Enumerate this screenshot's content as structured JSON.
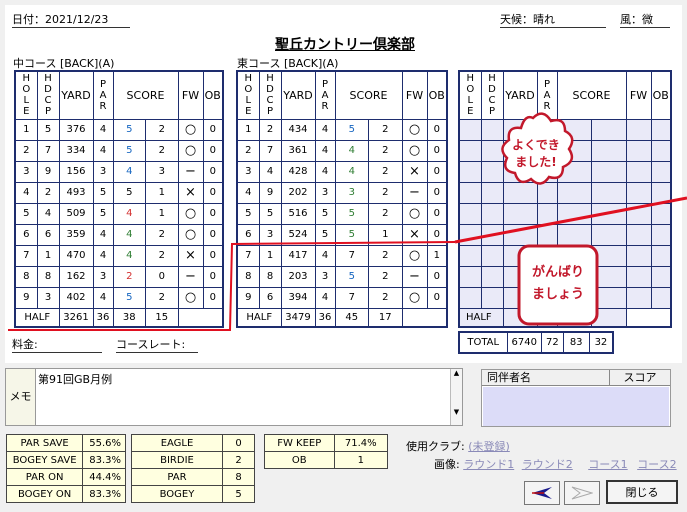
{
  "header": {
    "date_label": "日付：2021/12/23",
    "weather_label": "天候：晴れ",
    "wind_label": "風：微",
    "club_name": "聖丘カントリー倶楽部"
  },
  "course_in": {
    "label": "中コース [BACK](A)"
  },
  "course_out": {
    "label": "東コース [BACK](A)"
  },
  "columns": {
    "hole": "HOLE",
    "hdcp": "HDCP",
    "yard": "YARD",
    "par": "PAR",
    "score": "SCORE",
    "fw": "FW",
    "ob": "OB"
  },
  "rows_in": [
    {
      "hole": "1",
      "hdcp": "5",
      "yard": "376",
      "par": "4",
      "score": "5",
      "putt": "2",
      "fw": "○",
      "ob": "0",
      "color": "blue"
    },
    {
      "hole": "2",
      "hdcp": "7",
      "yard": "334",
      "par": "4",
      "score": "5",
      "putt": "2",
      "fw": "○",
      "ob": "0",
      "color": "blue"
    },
    {
      "hole": "3",
      "hdcp": "9",
      "yard": "156",
      "par": "3",
      "score": "4",
      "putt": "3",
      "fw": "−",
      "ob": "0",
      "color": "blue"
    },
    {
      "hole": "4",
      "hdcp": "2",
      "yard": "493",
      "par": "5",
      "score": "5",
      "putt": "1",
      "fw": "×",
      "ob": "0",
      "color": "black"
    },
    {
      "hole": "5",
      "hdcp": "4",
      "yard": "509",
      "par": "5",
      "score": "4",
      "putt": "1",
      "fw": "○",
      "ob": "0",
      "color": "red"
    },
    {
      "hole": "6",
      "hdcp": "6",
      "yard": "359",
      "par": "4",
      "score": "4",
      "putt": "2",
      "fw": "○",
      "ob": "0",
      "color": "green"
    },
    {
      "hole": "7",
      "hdcp": "1",
      "yard": "470",
      "par": "4",
      "score": "4",
      "putt": "2",
      "fw": "×",
      "ob": "0",
      "color": "green"
    },
    {
      "hole": "8",
      "hdcp": "8",
      "yard": "162",
      "par": "3",
      "score": "2",
      "putt": "0",
      "fw": "−",
      "ob": "0",
      "color": "red"
    },
    {
      "hole": "9",
      "hdcp": "3",
      "yard": "402",
      "par": "4",
      "score": "5",
      "putt": "2",
      "fw": "○",
      "ob": "0",
      "color": "blue"
    }
  ],
  "half_in": {
    "label": "HALF",
    "yard": "3261",
    "par": "36",
    "score": "38",
    "putt": "15"
  },
  "rows_out": [
    {
      "hole": "1",
      "hdcp": "2",
      "yard": "434",
      "par": "4",
      "score": "5",
      "putt": "2",
      "fw": "○",
      "ob": "0",
      "color": "blue"
    },
    {
      "hole": "2",
      "hdcp": "7",
      "yard": "361",
      "par": "4",
      "score": "4",
      "putt": "2",
      "fw": "○",
      "ob": "0",
      "color": "green"
    },
    {
      "hole": "3",
      "hdcp": "4",
      "yard": "428",
      "par": "4",
      "score": "4",
      "putt": "2",
      "fw": "×",
      "ob": "0",
      "color": "green"
    },
    {
      "hole": "4",
      "hdcp": "9",
      "yard": "202",
      "par": "3",
      "score": "3",
      "putt": "2",
      "fw": "−",
      "ob": "0",
      "color": "green"
    },
    {
      "hole": "5",
      "hdcp": "5",
      "yard": "516",
      "par": "5",
      "score": "5",
      "putt": "2",
      "fw": "○",
      "ob": "0",
      "color": "green"
    },
    {
      "hole": "6",
      "hdcp": "3",
      "yard": "524",
      "par": "5",
      "score": "5",
      "putt": "1",
      "fw": "×",
      "ob": "0",
      "color": "green"
    },
    {
      "hole": "7",
      "hdcp": "1",
      "yard": "417",
      "par": "4",
      "score": "7",
      "putt": "2",
      "fw": "○",
      "ob": "1",
      "color": "black"
    },
    {
      "hole": "8",
      "hdcp": "8",
      "yard": "203",
      "par": "3",
      "score": "5",
      "putt": "2",
      "fw": "−",
      "ob": "0",
      "color": "blue"
    },
    {
      "hole": "9",
      "hdcp": "6",
      "yard": "394",
      "par": "4",
      "score": "7",
      "putt": "2",
      "fw": "○",
      "ob": "0",
      "color": "black"
    }
  ],
  "half_out": {
    "label": "HALF",
    "yard": "3479",
    "par": "36",
    "score": "45",
    "putt": "17"
  },
  "half_extra": {
    "label": "HALF"
  },
  "total": {
    "label": "TOTAL",
    "yard": "6740",
    "par": "72",
    "score": "83",
    "putt": "32"
  },
  "stamps": {
    "stamp1": "よくでき\nました!",
    "stamp2": "がんばり\nましょう"
  },
  "fee_label": "料金:",
  "course_rate_label": "コースレート:",
  "memo": {
    "label": "メモ",
    "text": "第91回GB月例"
  },
  "companion": {
    "col_name": "同伴者名",
    "col_score": "スコア"
  },
  "stats1": [
    {
      "label": "PAR SAVE",
      "value": "55.6%"
    },
    {
      "label": "BOGEY SAVE",
      "value": "83.3%"
    },
    {
      "label": "PAR ON",
      "value": "44.4%"
    },
    {
      "label": "BOGEY ON",
      "value": "83.3%"
    }
  ],
  "stats2": [
    {
      "label": "EAGLE",
      "value": "0"
    },
    {
      "label": "BIRDIE",
      "value": "2"
    },
    {
      "label": "PAR",
      "value": "8"
    },
    {
      "label": "BOGEY",
      "value": "5"
    }
  ],
  "stats3": [
    {
      "label": "FW KEEP",
      "value": "71.4%"
    },
    {
      "label": "OB",
      "value": "1"
    }
  ],
  "clubs": {
    "label": "使用クラブ:",
    "link": "(未登録)"
  },
  "images": {
    "label": "画像:",
    "round1": "ラウンド1",
    "round2": "ラウンド2",
    "course1": "コース1",
    "course2": "コース2"
  },
  "buttons": {
    "close": "閉じる"
  },
  "colors": {
    "blue": "#1565c0",
    "green": "#2e7d32",
    "red": "#d32f2f",
    "black": "#000000",
    "frame": "#1e2d6e",
    "stamp": "#c2182b"
  }
}
